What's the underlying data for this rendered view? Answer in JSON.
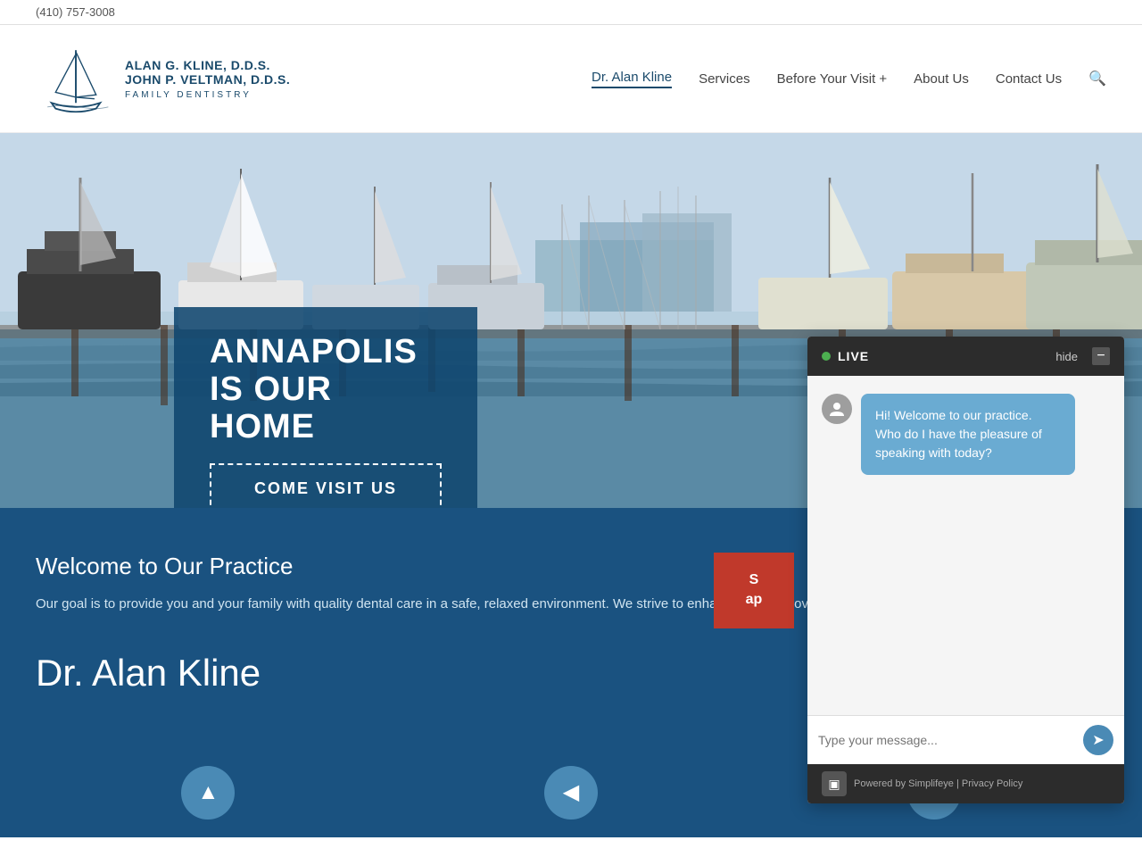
{
  "topbar": {
    "phone": "(410) 757-3008"
  },
  "header": {
    "logo": {
      "name1": "ALAN G. KLINE, D.D.S.",
      "name2": "JOHN P. VELTMAN, D.D.S.",
      "subtitle": "FAMILY  DENTISTRY"
    },
    "nav": {
      "items": [
        {
          "label": "Dr. Alan Kline",
          "active": true
        },
        {
          "label": "Services",
          "active": false
        },
        {
          "label": "Before Your Visit +",
          "active": false
        },
        {
          "label": "About Us",
          "active": false
        },
        {
          "label": "Contact Us",
          "active": false
        }
      ]
    }
  },
  "hero": {
    "heading_line1": "ANNAPOLIS",
    "heading_line2": "IS OUR HOME",
    "cta": "COME  VISIT  US"
  },
  "main": {
    "welcome_heading": "Welcome to Our Practice",
    "welcome_text": "Our goal is to provide you and your family with quality dental care in a safe, relaxed environment. We strive to enhance and improve your total oral health and well-being.",
    "schedule_btn_line1": "S",
    "schedule_btn_line2": "ap",
    "dr_heading": "Dr. Alan Kline"
  },
  "chat": {
    "header": {
      "live_label": "LIVE",
      "hide_label": "hide"
    },
    "message": "Hi! Welcome to our practice.  Who do I have the pleasure of speaking with today?",
    "input_placeholder": "Type your message...",
    "footer_text": "Powered by Simplifeye | Privacy Policy"
  }
}
